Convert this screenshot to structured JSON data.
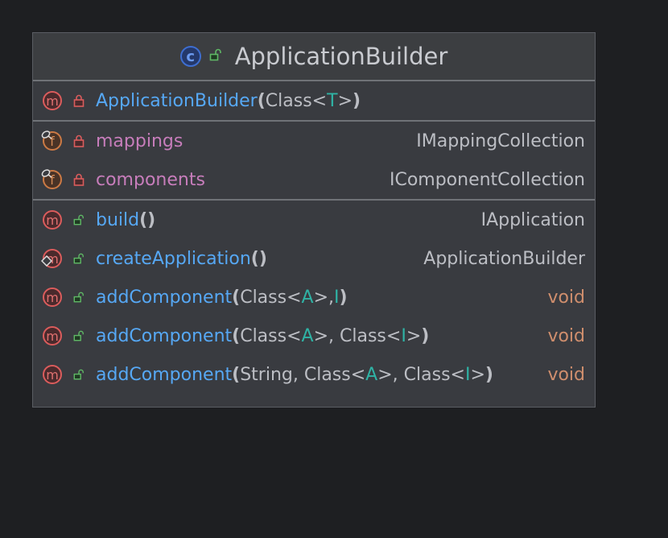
{
  "class": {
    "name": "ApplicationBuilder",
    "icon": "class-icon",
    "visibility": "public"
  },
  "sections": [
    [
      {
        "kind": "m",
        "vis": "private",
        "name": "ApplicationBuilder",
        "params": [
          {
            "t": "(",
            "c": "b"
          },
          {
            "t": "Class<",
            "c": ""
          },
          {
            "t": "T",
            "c": "g"
          },
          {
            "t": ">",
            "c": ""
          },
          {
            "t": ")",
            "c": "b"
          }
        ],
        "type": ""
      }
    ],
    [
      {
        "kind": "f",
        "vis": "private",
        "name": "mappings",
        "params": [],
        "type": "IMappingCollection",
        "overlay": "static"
      },
      {
        "kind": "f",
        "vis": "private",
        "name": "components",
        "params": [],
        "type": "IComponentCollection",
        "overlay": "static"
      }
    ],
    [
      {
        "kind": "m",
        "vis": "public",
        "name": "build",
        "params": [
          {
            "t": "()",
            "c": "b"
          }
        ],
        "type": "IApplication"
      },
      {
        "kind": "m",
        "vis": "public",
        "name": "createApplication",
        "params": [
          {
            "t": "()",
            "c": "b"
          }
        ],
        "type": "ApplicationBuilder",
        "overlay": "static-diamond"
      },
      {
        "kind": "m",
        "vis": "public",
        "name": "addComponent",
        "params": [
          {
            "t": "(",
            "c": "b"
          },
          {
            "t": "Class<",
            "c": ""
          },
          {
            "t": "A",
            "c": "g"
          },
          {
            "t": ">, ",
            "c": ""
          },
          {
            "t": "I",
            "c": "g"
          },
          {
            "t": ")",
            "c": "b"
          }
        ],
        "type": "void"
      },
      {
        "kind": "m",
        "vis": "public",
        "name": "addComponent",
        "params": [
          {
            "t": "(",
            "c": "b"
          },
          {
            "t": "Class<",
            "c": ""
          },
          {
            "t": "A",
            "c": "g"
          },
          {
            "t": ">, Class<",
            "c": ""
          },
          {
            "t": "I",
            "c": "g"
          },
          {
            "t": ">",
            "c": ""
          },
          {
            "t": ")",
            "c": "b"
          }
        ],
        "type": "void"
      },
      {
        "kind": "m",
        "vis": "public",
        "name": "addComponent",
        "params": [
          {
            "t": "(",
            "c": "b"
          },
          {
            "t": "String, Class<",
            "c": ""
          },
          {
            "t": "A",
            "c": "g"
          },
          {
            "t": ">, Class<",
            "c": ""
          },
          {
            "t": "I",
            "c": "g"
          },
          {
            "t": ">",
            "c": ""
          },
          {
            "t": ")",
            "c": "b"
          }
        ],
        "type": "void"
      }
    ]
  ],
  "colors": {
    "method": "#56a8f5",
    "field": "#c77dbb",
    "generic": "#2fb3a5",
    "void": "#cf8e6d"
  }
}
